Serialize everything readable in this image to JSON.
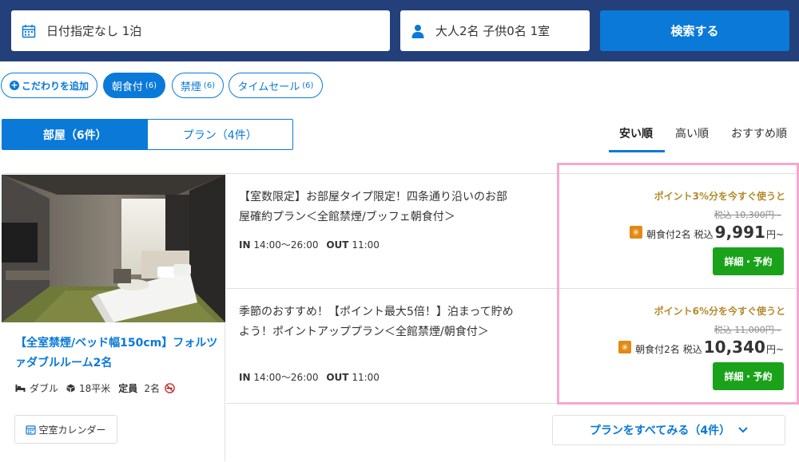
{
  "search": {
    "date_label": "日付指定なし 1泊",
    "guests_label": "大人2名 子供0名 1室",
    "search_button": "検索する"
  },
  "filters": {
    "add_label": "こだわりを追加",
    "chips": [
      {
        "label": "朝食付",
        "count": "(6)",
        "active": true
      },
      {
        "label": "禁煙",
        "count": "(6)",
        "active": false
      },
      {
        "label": "タイムセール",
        "count": "(6)",
        "active": false
      }
    ]
  },
  "view_tabs": {
    "rooms": "部屋（6件）",
    "plans": "プラン（4件）"
  },
  "sort": {
    "options": [
      "安い順",
      "高い順",
      "おすすめ順"
    ],
    "active": "安い順"
  },
  "room": {
    "title": "【全室禁煙/ベッド幅150cm】フォルツァダブルルーム2名",
    "bed": "ダブル",
    "size": "18平米",
    "capacity_label": "定員",
    "capacity": "2名",
    "calendar_button": "空室カレンダー"
  },
  "plans": [
    {
      "name": "【室数限定】お部屋タイプ限定！四条通り沿いのお部屋確約プラン＜全館禁煙/ブッフェ朝食付＞",
      "checkin_label": "IN",
      "checkin": "14:00～26:00",
      "checkout_label": "OUT",
      "checkout": "11:00",
      "points": "ポイント3%分を今すぐ使うと",
      "original_price": "税込 10,300円~",
      "meal": "朝食付2名",
      "tax_label": "税込",
      "price": "9,991",
      "price_suffix": "円~",
      "reserve_button": "詳細・予約"
    },
    {
      "name": "季節のおすすめ！【ポイント最大5倍！】泊まって貯めよう！ポイントアッププラン＜全館禁煙/朝食付＞",
      "checkin_label": "IN",
      "checkin": "14:00～26:00",
      "checkout_label": "OUT",
      "checkout": "11:00",
      "points": "ポイント6%分を今すぐ使うと",
      "original_price": "税込 11,000円~",
      "meal": "朝食付2名",
      "tax_label": "税込",
      "price": "10,340",
      "price_suffix": "円~",
      "reserve_button": "詳細・予約"
    }
  ],
  "see_all_button": "プランをすべてみる（4件）",
  "colors": {
    "header_bg": "#23407a",
    "accent_blue": "#0a79d8",
    "reserve_green": "#1aa21a",
    "points_gold": "#b38a2b",
    "highlight_pink": "#f4a9cf"
  }
}
